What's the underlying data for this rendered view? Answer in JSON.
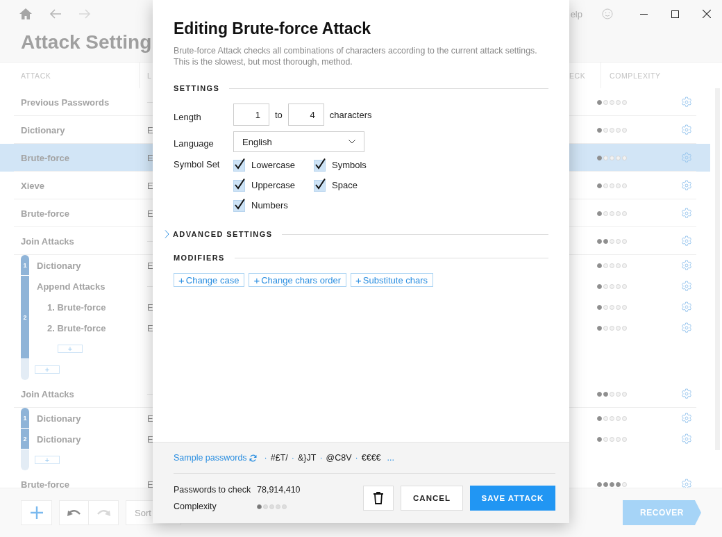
{
  "app": {
    "title": "Attack Setting",
    "help": "elp",
    "columns": [
      {
        "label": "ATTACK"
      },
      {
        "label": "L"
      },
      {
        "label": "ECK"
      },
      {
        "label": "COMPLEXITY"
      }
    ],
    "rows": [
      {
        "kind": "attack",
        "name": "Previous Passwords",
        "stars": 1,
        "selected": false
      },
      {
        "kind": "attack",
        "name": "Dictionary",
        "language": "E",
        "stars": 1,
        "selected": false
      },
      {
        "kind": "attack",
        "name": "Brute-force",
        "language": "E",
        "stars": 1,
        "selected": true
      },
      {
        "kind": "attack",
        "name": "Xieve",
        "language": "E",
        "stars": 1,
        "selected": false
      },
      {
        "kind": "attack",
        "name": "Brute-force",
        "language": "E",
        "stars": 1,
        "selected": false
      },
      {
        "kind": "join",
        "name": "Join Attacks",
        "stars": 2,
        "selected": false,
        "add": "+",
        "parts": [
          {
            "number": "1",
            "rows": [
              {
                "kind": "attack",
                "name": "Dictionary",
                "language": "E",
                "stars": 1,
                "selected": false
              }
            ]
          },
          {
            "number": "2",
            "rows": [
              {
                "kind": "append",
                "name": "Append Attacks",
                "stars": 1,
                "add": "+",
                "children": [
                  {
                    "name": "1. Brute-force",
                    "language": "E",
                    "stars": 1,
                    "selected": false
                  },
                  {
                    "name": "2. Brute-force",
                    "language": "E",
                    "stars": 1,
                    "selected": false
                  }
                ]
              }
            ]
          }
        ]
      },
      {
        "kind": "join",
        "name": "Join Attacks",
        "stars": 2,
        "selected": false,
        "add": "+",
        "parts": [
          {
            "number": "1",
            "rows": [
              {
                "kind": "attack",
                "name": "Dictionary",
                "language": "E",
                "stars": 1,
                "selected": false
              }
            ]
          },
          {
            "number": "2",
            "rows": [
              {
                "kind": "attack",
                "name": "Dictionary",
                "language": "E",
                "stars": 1,
                "selected": false
              }
            ]
          }
        ]
      },
      {
        "kind": "attack",
        "name": "Brute-force",
        "language": "E",
        "stars": 4,
        "selected": false
      }
    ],
    "toolbar": {
      "undo_disabled": false,
      "redo_disabled": true,
      "sort": "Sort"
    },
    "recover": "RECOVER"
  },
  "dialog": {
    "title": "Editing Brute-force Attack",
    "description": "Brute-force Attack checks all combinations of characters according to the current attack settings. This is the slowest, but most thorough, method.",
    "settings_heading": "SETTINGS",
    "length": {
      "label": "Length",
      "from": "1",
      "separator": "to",
      "to": "4",
      "unit": "characters"
    },
    "language": {
      "label": "Language",
      "value": "English"
    },
    "symbol_set": {
      "label": "Symbol Set",
      "options": [
        {
          "label": "Lowercase",
          "checked": true
        },
        {
          "label": "Symbols",
          "checked": true
        },
        {
          "label": "Uppercase",
          "checked": true
        },
        {
          "label": "Space",
          "checked": true
        },
        {
          "label": "Numbers",
          "checked": true
        }
      ]
    },
    "advanced": {
      "label": "ADVANCED SETTINGS",
      "expanded": false
    },
    "modifiers": {
      "label": "MODIFIERS",
      "buttons": [
        {
          "icon": "+",
          "label": "Change case"
        },
        {
          "icon": "+",
          "label": "Change chars order"
        },
        {
          "icon": "+",
          "label": "Substitute chars"
        }
      ]
    },
    "footer": {
      "sample_link": "Sample passwords",
      "separator": "·",
      "samples": [
        "#£T/",
        "&}JT",
        "@C8V",
        "€€€€"
      ],
      "more": "...",
      "passwords_label": "Passwords to check",
      "passwords_value": "78,914,410",
      "complexity_label": "Complexity",
      "complexity": {
        "stars": 1
      },
      "cancel": "CANCEL",
      "save": "SAVE ATTACK"
    }
  }
}
